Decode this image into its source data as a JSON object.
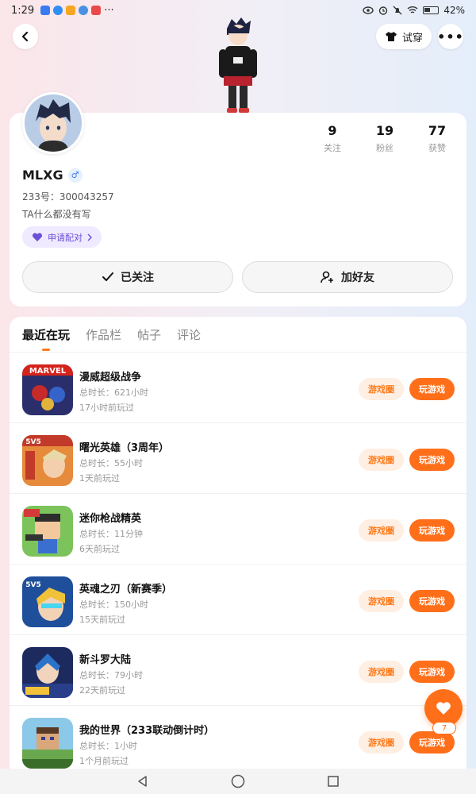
{
  "status_bar": {
    "time": "1:29",
    "battery": "42%",
    "dots": "···"
  },
  "header": {
    "try_on_label": "试穿",
    "more_label": "•••"
  },
  "profile": {
    "username": "MLXG",
    "gender_symbol": "♂",
    "uid": "233号：300043257",
    "bio": "TA什么都没有写",
    "pair_label": "申请配对",
    "stats": [
      {
        "num": "9",
        "label": "关注"
      },
      {
        "num": "19",
        "label": "粉丝"
      },
      {
        "num": "77",
        "label": "获赞"
      }
    ],
    "followed_label": "已关注",
    "add_friend_label": "加好友"
  },
  "tabs": [
    "最近在玩",
    "作品栏",
    "帖子",
    "评论"
  ],
  "games": [
    {
      "name": "漫威超级战争",
      "time": "总时长：621小时",
      "last": "17小时前玩过",
      "icon": "marvel-game-icon",
      "circle_label": "游戏圈",
      "play_label": "玩游戏"
    },
    {
      "name": "曙光英雄（3周年）",
      "time": "总时长：55小时",
      "last": "1天前玩过",
      "icon": "dawn-heroes-game-icon",
      "circle_label": "游戏圈",
      "play_label": "玩游戏"
    },
    {
      "name": "迷你枪战精英",
      "time": "总时长：11分钟",
      "last": "6天前玩过",
      "icon": "mini-gunfight-game-icon",
      "circle_label": "游戏圈",
      "play_label": "玩游戏"
    },
    {
      "name": "英魂之刃（新赛季）",
      "time": "总时长：150小时",
      "last": "15天前玩过",
      "icon": "soul-blade-game-icon",
      "circle_label": "游戏圈",
      "play_label": "玩游戏"
    },
    {
      "name": "新斗罗大陆",
      "time": "总时长：79小时",
      "last": "22天前玩过",
      "icon": "douluo-game-icon",
      "circle_label": "游戏圈",
      "play_label": "玩游戏"
    },
    {
      "name": "我的世界（233联动倒计时）",
      "time": "总时长：1小时",
      "last": "1个月前玩过",
      "icon": "minecraft-game-icon",
      "circle_label": "游戏圈",
      "play_label": "玩游戏"
    }
  ],
  "fab": {
    "like_count": "7"
  },
  "colors": {
    "accent": "#ff6f1a",
    "accent_light": "#ffeee2",
    "pair_purple": "#6a4fd8"
  }
}
